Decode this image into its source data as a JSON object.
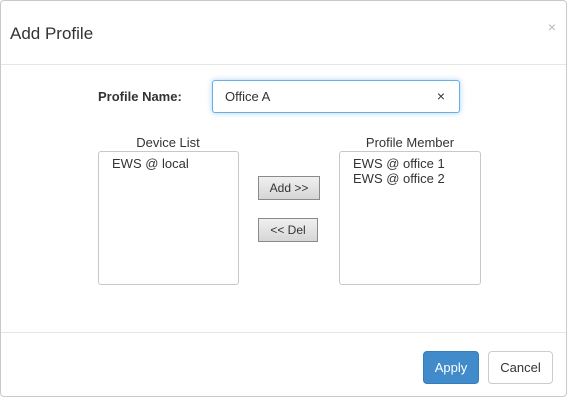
{
  "dialog": {
    "title": "Add Profile",
    "close_glyph": "×"
  },
  "profile_name": {
    "label": "Profile Name:",
    "value": "Office A",
    "clear_glyph": "×"
  },
  "device_list": {
    "label": "Device List",
    "items": [
      "EWS @ local"
    ]
  },
  "profile_member": {
    "label": "Profile Member",
    "items": [
      "EWS @ office 1",
      "EWS @ office 2"
    ]
  },
  "buttons": {
    "add": "Add >>",
    "del": "<< Del",
    "apply": "Apply",
    "cancel": "Cancel"
  },
  "colors": {
    "primary": "#428bca",
    "focus_border": "#66afe9"
  }
}
